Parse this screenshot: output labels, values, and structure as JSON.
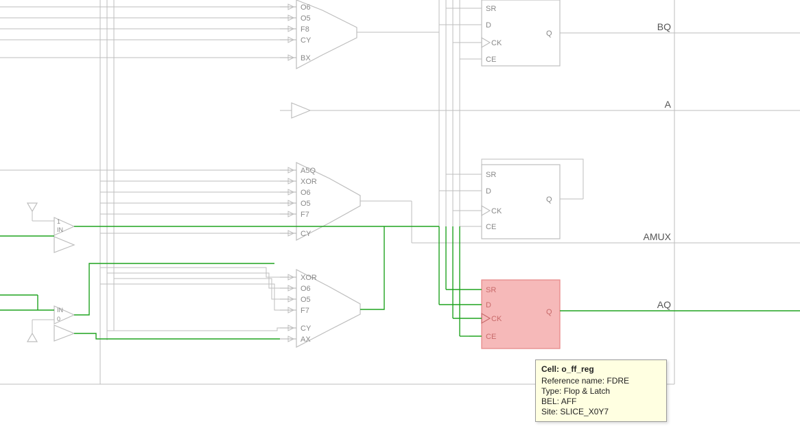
{
  "ports": {
    "bq": "BQ",
    "a": "A",
    "amux": "AMUX",
    "aq": "AQ"
  },
  "mux": {
    "top": {
      "pins": [
        "O6",
        "O5",
        "F8",
        "CY",
        "BX"
      ]
    },
    "mid": {
      "pins": [
        "A5Q",
        "XOR",
        "O6",
        "O5",
        "F7",
        "CY"
      ]
    },
    "bot": {
      "pins": [
        "XOR",
        "O6",
        "O5",
        "F7",
        "CY",
        "AX"
      ]
    }
  },
  "ff": {
    "pins_in": [
      "SR",
      "D",
      "CK",
      "CE"
    ],
    "pin_out": "Q"
  },
  "buf": {
    "top": {
      "t": "1",
      "b": "IN"
    },
    "bot": {
      "t": "IN",
      "b": "0"
    }
  },
  "tooltip": {
    "title": "Cell: o_ff_reg",
    "rows": [
      "Reference name: FDRE",
      "Type: Flop & Latch",
      "BEL: AFF",
      "Site: SLICE_X0Y7"
    ]
  }
}
